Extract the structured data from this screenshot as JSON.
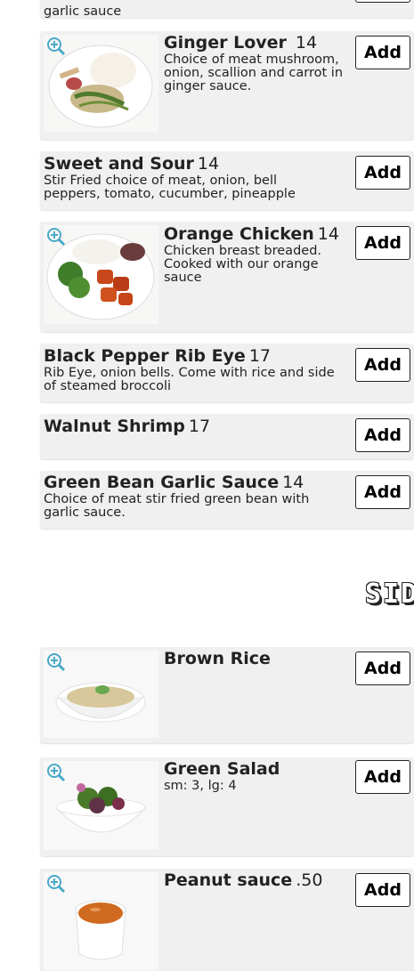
{
  "top_partial": {
    "desc": "garlic sauce"
  },
  "items": [
    {
      "name": "Ginger Lover",
      "price": "14",
      "desc": "Choice of meat mushroom, onion, scallion and carrot in ginger sauce.",
      "add_label": "Add"
    },
    {
      "name": "Sweet and Sour",
      "price": "14",
      "desc": "Stir Fried choice of meat, onion, bell peppers, tomato, cucumber, pineapple",
      "add_label": "Add"
    },
    {
      "name": "Orange Chicken",
      "price": "14",
      "desc": "Chicken breast breaded. Cooked with our orange sauce",
      "add_label": "Add"
    },
    {
      "name": "Black Pepper Rib Eye",
      "price": "17",
      "desc": "Rib Eye, onion bells. Come with rice and side of steamed broccoli",
      "add_label": "Add"
    },
    {
      "name": "Walnut Shrimp",
      "price": "17",
      "desc": "",
      "add_label": "Add"
    },
    {
      "name": "Green Bean Garlic Sauce",
      "price": "14",
      "desc": "Choice of meat stir fried green bean with garlic sauce.",
      "add_label": "Add"
    }
  ],
  "sides": {
    "title": "SID",
    "items": [
      {
        "name": "Brown Rice",
        "price": "",
        "desc": "",
        "add_label": "Add"
      },
      {
        "name": "Green Salad",
        "price": "",
        "desc": "sm: 3, lg: 4",
        "add_label": "Add"
      },
      {
        "name": "Peanut sauce",
        "price": ".50",
        "desc": "",
        "add_label": "Add"
      }
    ]
  }
}
